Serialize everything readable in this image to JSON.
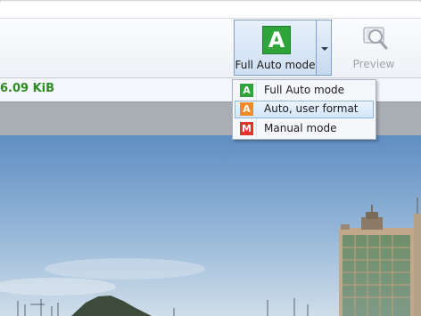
{
  "toolbar": {
    "mode_button": {
      "label": "Full Auto mode",
      "icon_letter": "A",
      "icon_color": "#2ea43b"
    },
    "preview_button": {
      "label": "Preview",
      "enabled": false
    }
  },
  "status": {
    "size_text": "6.09 KiB",
    "color": "#2f8a24"
  },
  "menu": {
    "items": [
      {
        "label": "Full Auto mode",
        "icon_letter": "A",
        "icon_color": "#2ea43b"
      },
      {
        "label": "Auto, user format",
        "icon_letter": "A",
        "icon_color": "#f08a24",
        "highlighted": true
      },
      {
        "label": "Manual mode",
        "icon_letter": "M",
        "icon_color": "#e5322d"
      }
    ]
  }
}
